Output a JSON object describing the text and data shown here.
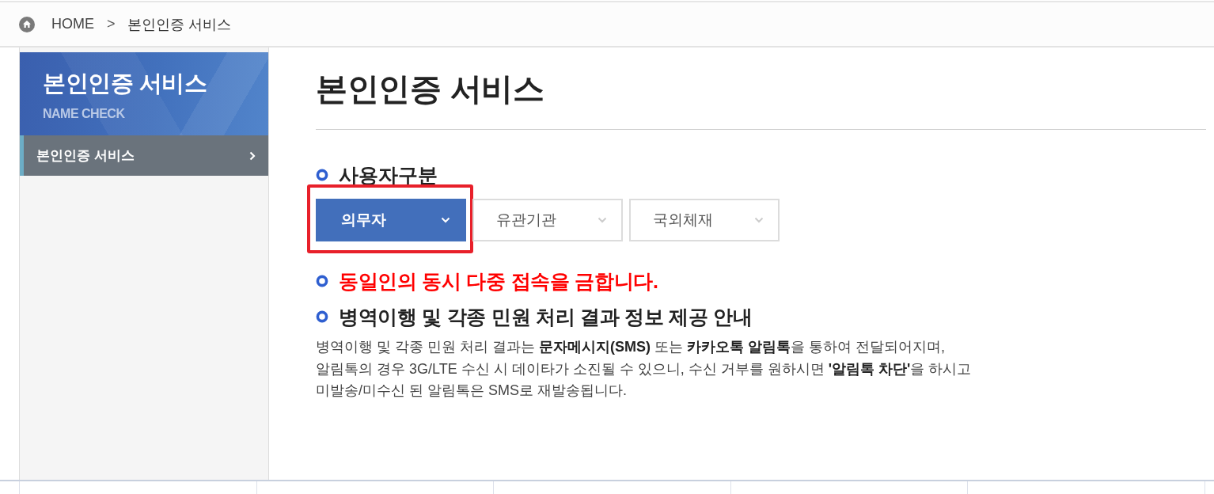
{
  "breadcrumb": {
    "items": [
      {
        "label": "HOME"
      },
      {
        "label": "본인인증 서비스"
      }
    ],
    "separator": ">"
  },
  "sidebar": {
    "title": "본인인증 서비스",
    "subtitle": "NAME CHECK",
    "items": [
      {
        "label": "본인인증 서비스",
        "selected": true
      }
    ]
  },
  "page_title": "본인인증 서비스",
  "user_type": {
    "heading": "사용자구분",
    "options": [
      {
        "label": "의무자",
        "selected": true,
        "highlighted": true
      },
      {
        "label": "유관기관",
        "selected": false,
        "highlighted": false
      },
      {
        "label": "국외체재",
        "selected": false,
        "highlighted": false
      }
    ]
  },
  "notices": [
    {
      "kind": "warning",
      "text": "동일인의 동시 다중 접속을 금합니다."
    },
    {
      "kind": "heading",
      "text": "병역이행 및 각종 민원 처리 결과 정보 제공 안내"
    }
  ],
  "paragraph": "병역이행 및 각종 민원 처리 결과는 **문자메시지(SMS)** 또는 **카카오톡 알림톡**을 통하여 전달되어지며,\n알림톡의 경우 3G/LTE 수신 시 데이타가 소진될 수 있으니, 수신 거부를 원하시면 **'알림톡 차단'**을 하시고\n미발송/미수신 된 알림톡은 SMS로 재발송됩니다."
}
